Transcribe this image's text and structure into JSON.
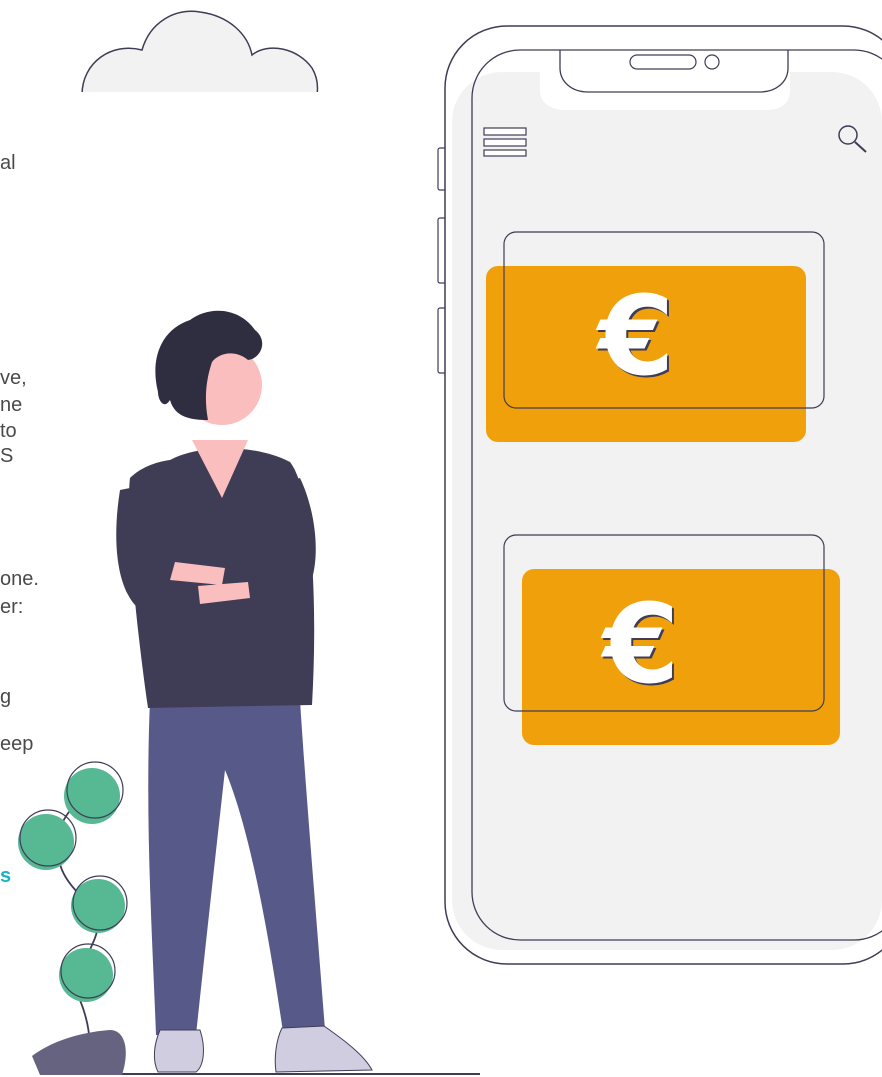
{
  "text_fragments": [
    "al",
    "ve,",
    "ne",
    "to",
    "S",
    "one.",
    "er:",
    "g",
    "eep",
    "s"
  ],
  "phone": {
    "cards": [
      {
        "symbol": "€"
      },
      {
        "symbol": "€"
      }
    ]
  },
  "colors": {
    "accent": "#f0a00a",
    "person_shirt": "#3f3d56",
    "person_pants": "#575a89",
    "skin": "#fbbebe",
    "leaf": "#57b894",
    "link": "#1ab3c6",
    "screen": "#f2f2f2"
  }
}
